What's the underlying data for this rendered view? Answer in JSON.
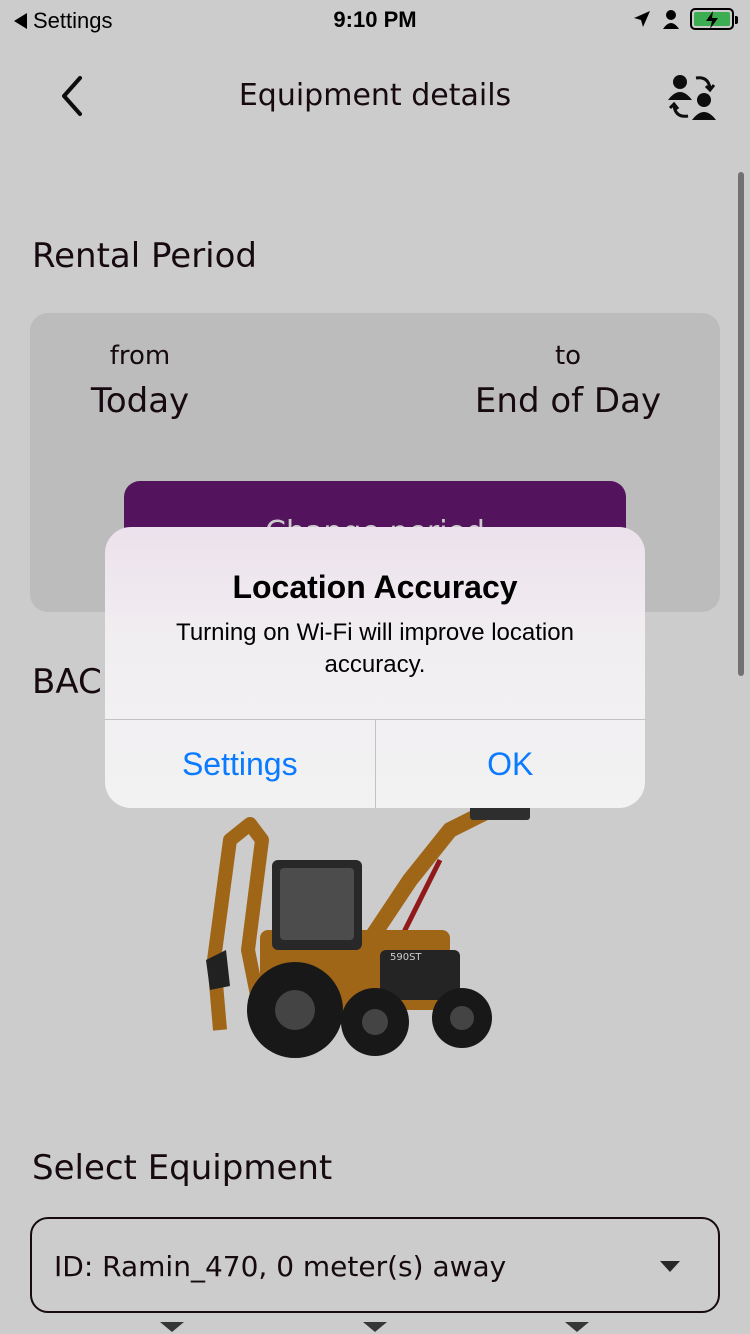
{
  "status_bar": {
    "back_label": "Settings",
    "time": "9:10 PM"
  },
  "nav": {
    "title": "Equipment details",
    "back_icon": "chevron-left-icon",
    "right_icon": "swap-users-icon"
  },
  "rental_period": {
    "title": "Rental Period",
    "from_label": "from",
    "from_value": "Today",
    "to_label": "to",
    "to_value": "End of Day",
    "change_button_label": "Change period"
  },
  "equipment": {
    "type_title": "BACKHOE LOADER"
  },
  "select_equipment": {
    "title": "Select Equipment",
    "selected": "ID: Ramin_470, 0 meter(s) away"
  },
  "alert": {
    "title": "Location Accuracy",
    "message": "Turning on Wi-Fi will improve location accuracy.",
    "settings_label": "Settings",
    "ok_label": "OK"
  },
  "colors": {
    "accent": "#6a1a75",
    "ios_blue": "#0a7aff",
    "battery_green": "#4cd964"
  }
}
